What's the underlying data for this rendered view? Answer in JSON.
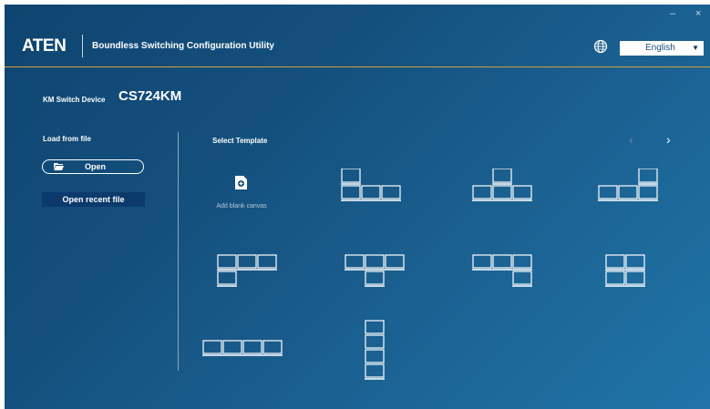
{
  "app": {
    "logo": "ATEN",
    "title": "Boundless Switching Configuration Utility",
    "language": "English",
    "minimize_glyph": "–",
    "close_glyph": "×"
  },
  "device": {
    "label": "KM Switch Device",
    "name": "CS724KM"
  },
  "load": {
    "label": "Load from file",
    "open_label": "Open",
    "recent_label": "Open recent file"
  },
  "templates": {
    "label": "Select Template",
    "blank_label": "Add blank canvas",
    "prev_glyph": "‹",
    "next_glyph": "›"
  },
  "icons": {
    "globe": "globe-icon",
    "folder": "folder-open-icon",
    "document": "document-plus-icon",
    "dropdown": "chevron-down-icon"
  },
  "colors": {
    "accent_line": "#d29f3e",
    "recent_button_bg": "#0c3a6c"
  }
}
